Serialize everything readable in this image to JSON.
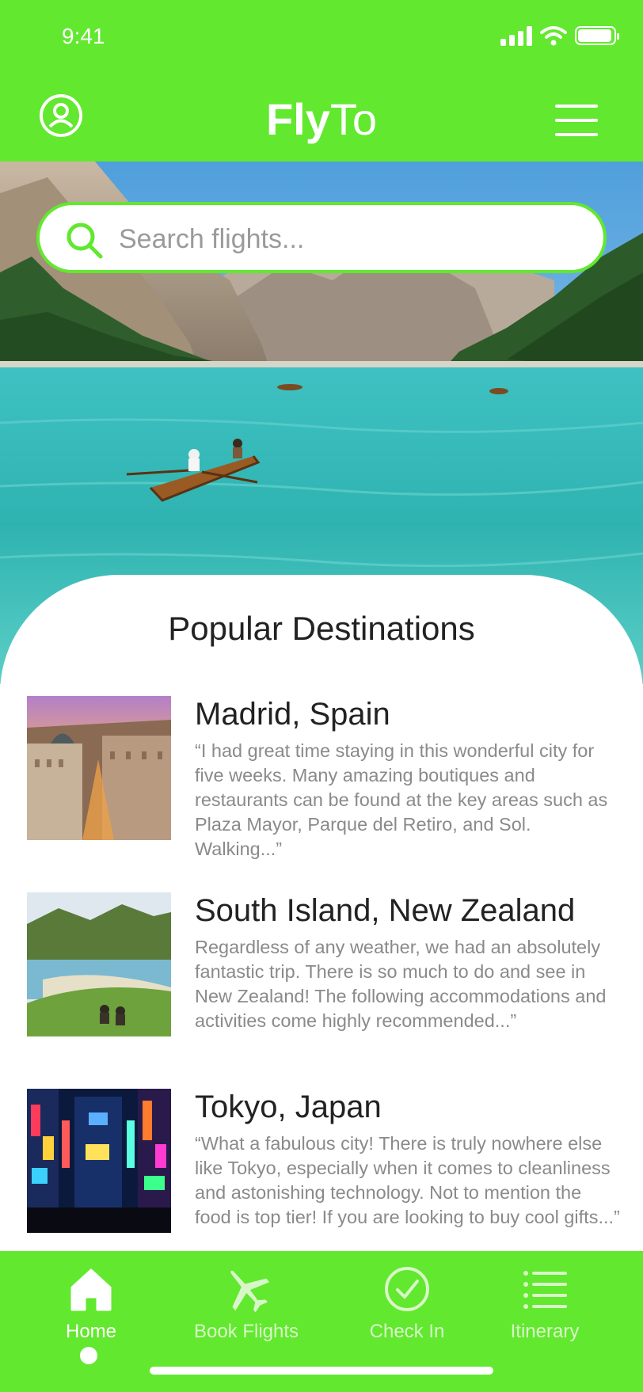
{
  "status_bar": {
    "time": "9:41"
  },
  "header": {
    "brand_bold": "Fly",
    "brand_light": "To"
  },
  "search": {
    "placeholder": "Search flights..."
  },
  "main": {
    "section_title": "Popular Destinations",
    "destinations": [
      {
        "name": "Madrid, Spain",
        "description": "“I had great time staying in this wonderful city for five weeks. Many amazing boutiques and restaurants can be found at the key areas such as Plaza Mayor, Parque del Retiro, and Sol. Walking...”"
      },
      {
        "name": "South Island, New Zealand",
        "description": "Regardless of any weather, we had an absolutely fantastic trip. There is so much to do and see in New Zealand! The following accommodations and activities come highly recommended...”"
      },
      {
        "name": "Tokyo, Japan",
        "description": "“What a fabulous city! There is truly nowhere else like Tokyo, especially when it comes to cleanliness and astonishing technology. Not to mention the food is top tier! If you are looking to buy cool gifts...”"
      }
    ]
  },
  "bottom_nav": {
    "items": [
      {
        "label": "Home",
        "icon": "home-icon",
        "active": true
      },
      {
        "label": "Book Flights",
        "icon": "airplane-icon",
        "active": false
      },
      {
        "label": "Check In",
        "icon": "check-circle-icon",
        "active": false
      },
      {
        "label": "Itinerary",
        "icon": "list-icon",
        "active": false
      }
    ]
  },
  "colors": {
    "accent": "#62e82f",
    "text_dark": "#222222",
    "text_muted": "#8a8a8a"
  }
}
